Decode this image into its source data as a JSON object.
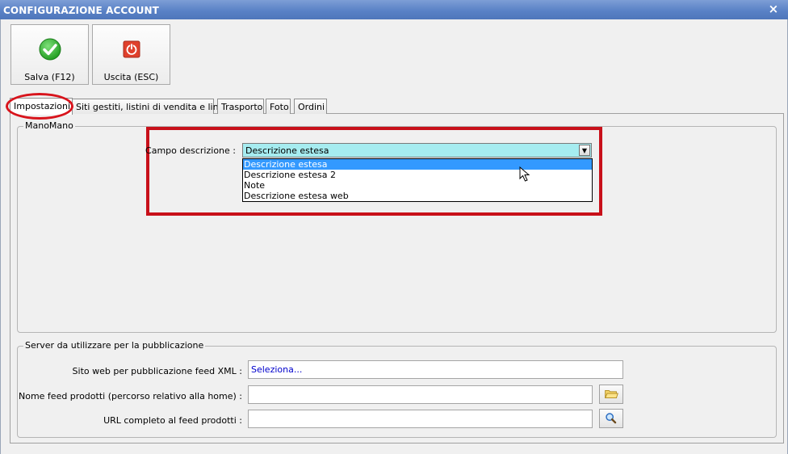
{
  "window": {
    "title": "CONFIGURAZIONE ACCOUNT",
    "close_glyph": "×"
  },
  "toolbar": {
    "save_label": "Salva (F12)",
    "save_icon": "check-icon",
    "exit_label": "Uscita (ESC)",
    "exit_icon": "power-icon"
  },
  "tabs": [
    {
      "label": "Impostazioni",
      "active": true
    },
    {
      "label": "Siti gestiti, listini di vendita e lingue"
    },
    {
      "label": "Trasporto"
    },
    {
      "label": "Foto"
    },
    {
      "label": "Ordini"
    }
  ],
  "manomano": {
    "group_title": "ManoMano",
    "campo_label": "Campo descrizione :",
    "campo_value": "Descrizione estesa",
    "options": [
      "Descrizione estesa",
      "Descrizione estesa 2",
      "Note",
      "Descrizione estesa web"
    ]
  },
  "server": {
    "group_title": "Server da utilizzare per la pubblicazione",
    "sito_label": "Sito web per pubblicazione feed XML :",
    "sito_value": "Seleziona...",
    "nome_label": "Nome feed prodotti (percorso relativo alla home) :",
    "nome_value": "",
    "url_label": "URL completo al feed prodotti :",
    "url_value": "",
    "folder_icon": "folder-icon",
    "search_icon": "magnifier-icon"
  },
  "colors": {
    "accent_red": "#c8101a",
    "combo_bg": "#a6ecf0",
    "selection": "#3399ff",
    "link_blue": "#0000cc"
  }
}
